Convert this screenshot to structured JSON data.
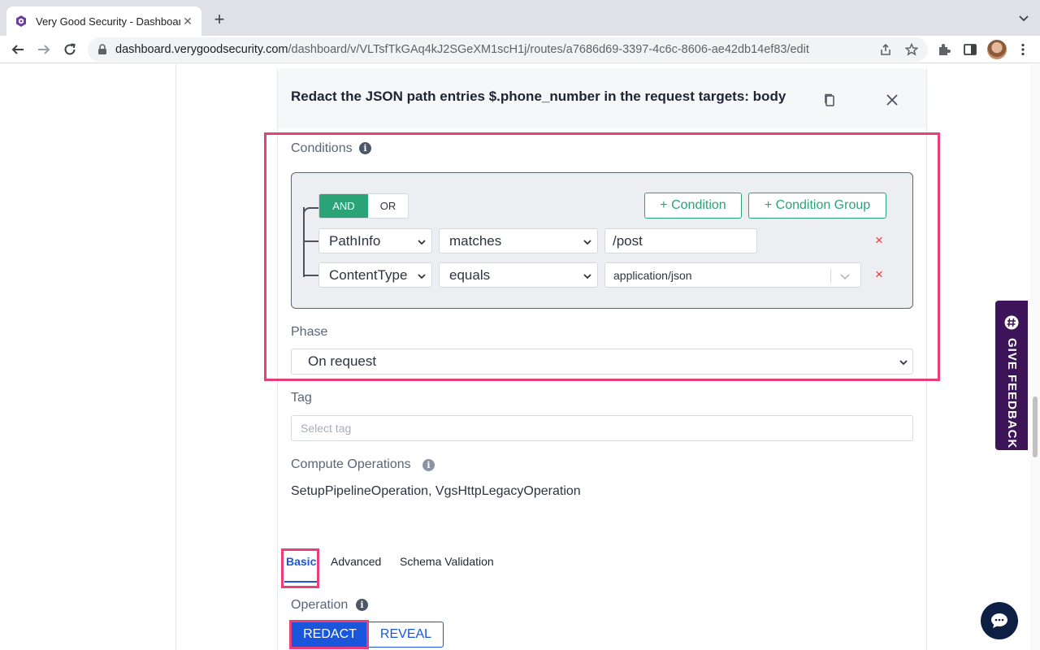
{
  "browser": {
    "tab_title": "Very Good Security - Dashboard",
    "new_tab": "+",
    "url_host": "dashboard.verygoodsecurity.com",
    "url_path": "/dashboard/v/VLTsfTkGAq4kJ2SGeXM1scH1j/routes/a7686d69-3397-4c6c-8606-ae42db14ef83/edit"
  },
  "panel": {
    "title": "Redact the JSON path entries $.phone_number in the request targets: body"
  },
  "conditions": {
    "label": "Conditions",
    "and_label": "AND",
    "or_label": "OR",
    "add_condition": "+ Condition",
    "add_group": "+ Condition Group",
    "rows": [
      {
        "field": "PathInfo",
        "operator": "matches",
        "value": "/post"
      },
      {
        "field": "ContentType",
        "operator": "equals",
        "value": "application/json"
      }
    ],
    "remove_glyph": "×"
  },
  "phase": {
    "label": "Phase",
    "value": "On request"
  },
  "tag": {
    "label": "Tag",
    "placeholder": "Select tag"
  },
  "compute": {
    "label": "Compute Operations",
    "value": "SetupPipelineOperation, VgsHttpLegacyOperation"
  },
  "tabs": [
    "Basic",
    "Advanced",
    "Schema Validation"
  ],
  "operation": {
    "label": "Operation",
    "redact": "REDACT",
    "reveal": "REVEAL"
  },
  "feedback": {
    "label": "GIVE FEEDBACK"
  },
  "colors": {
    "accent_green": "#2aa377",
    "highlight_pink": "#e83e79",
    "primary_blue": "#1a56db",
    "feedback_purple": "#3d1457",
    "danger_red": "#e33b3b"
  }
}
